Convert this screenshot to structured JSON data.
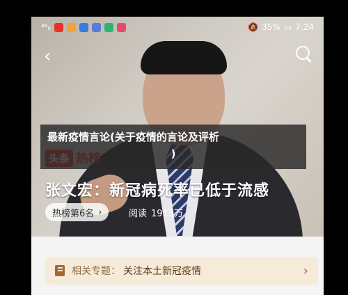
{
  "status_bar": {
    "network": "⁴⁶ᵢₗ",
    "battery_percent": "35%",
    "time": "7:24",
    "app_icon_colors": [
      "#e8302a",
      "#f2a23a",
      "#3a7be0",
      "#5a7ad8",
      "#2bb673",
      "#e84a6a"
    ]
  },
  "article": {
    "badge_left": "头条",
    "badge_right": "热榜",
    "headline": "张文宏：新冠病死率已低于流感",
    "rank": "热榜第6名",
    "rank_chevron": "›",
    "read_label": "阅读",
    "read_count": "1913万"
  },
  "topic": {
    "label": "相关专题：",
    "name": "关注本土新冠疫情",
    "chevron": "›"
  },
  "caption": {
    "line1": "最新疫情言论(关于疫情的言论及评析",
    "line2": ")"
  },
  "nav": {
    "back": "‹"
  }
}
